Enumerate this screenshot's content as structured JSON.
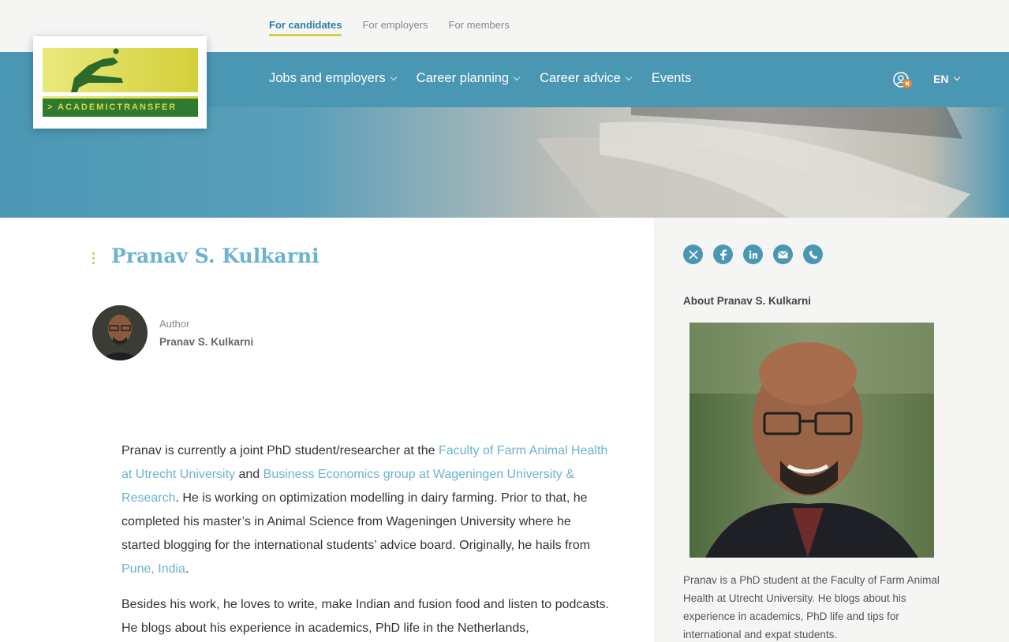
{
  "audience": {
    "items": [
      {
        "label": "For candidates",
        "active": true
      },
      {
        "label": "For employers",
        "active": false
      },
      {
        "label": "For members",
        "active": false
      }
    ]
  },
  "logo": {
    "text": "> ACADEMICTRANSFER"
  },
  "nav": {
    "items": [
      {
        "label": "Jobs and employers",
        "has_dropdown": true
      },
      {
        "label": "Career planning",
        "has_dropdown": true
      },
      {
        "label": "Career advice",
        "has_dropdown": true
      },
      {
        "label": "Events",
        "has_dropdown": false
      }
    ],
    "language": "EN",
    "user_icon": "user-logged-out-icon"
  },
  "article": {
    "title": "Pranav S. Kulkarni",
    "author_label": "Author",
    "author_name": "Pranav S. Kulkarni",
    "p1_a": "Pranav is currently a joint PhD student/researcher at the ",
    "link1": "Faculty of Farm Animal Health at Utrecht University",
    "p1_b": " and ",
    "link2": "Business Economics group at Wageningen University & Research",
    "p1_c": ". He is working on optimization modelling in dairy farming. Prior to that, he completed his master’s in Animal Science from Wageningen University where he started blogging for the international students’ advice board. Originally, he hails from ",
    "link3": "Pune, India",
    "p1_d": ".",
    "p2": "Besides his work, he loves to write, make Indian and fusion food and listen to podcasts. He blogs about his experience in academics, PhD life in the Netherlands,"
  },
  "sidebar": {
    "share_icons": [
      "x-icon",
      "facebook-icon",
      "linkedin-icon",
      "email-icon",
      "whatsapp-icon"
    ],
    "about_title": "About Pranav S. Kulkarni",
    "about_text": "Pranav is a PhD student at the Faculty of Farm Animal Health at Utrecht University. He blogs about his experience in academics, PhD life and tips for international and expat students."
  },
  "colors": {
    "brand_blue": "#4a97b4",
    "link_blue": "#6bb3cf",
    "accent_yellow": "#d6d04a",
    "logo_green": "#2f7a2e"
  }
}
